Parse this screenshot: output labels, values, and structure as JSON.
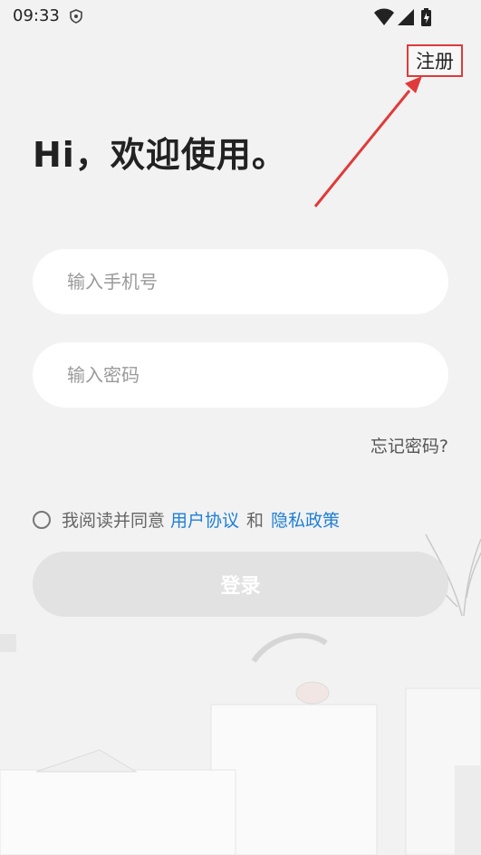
{
  "status_bar": {
    "time": "09:33",
    "icons": [
      "shield-icon",
      "wifi-icon",
      "signal-icon",
      "battery-icon"
    ]
  },
  "header": {
    "register_label": "注册"
  },
  "main": {
    "title": "Hi，欢迎使用。",
    "phone_placeholder": "输入手机号",
    "password_placeholder": "输入密码",
    "forgot_label": "忘记密码?",
    "agreement": {
      "prefix": "我阅读并同意",
      "user_agreement": "用户协议",
      "conjunction": "和",
      "privacy_policy": "隐私政策"
    },
    "login_label": "登录"
  },
  "colors": {
    "accent_link": "#1e7fd6",
    "highlight_border": "#e03a3a",
    "disabled_button": "#e2e2e2"
  }
}
